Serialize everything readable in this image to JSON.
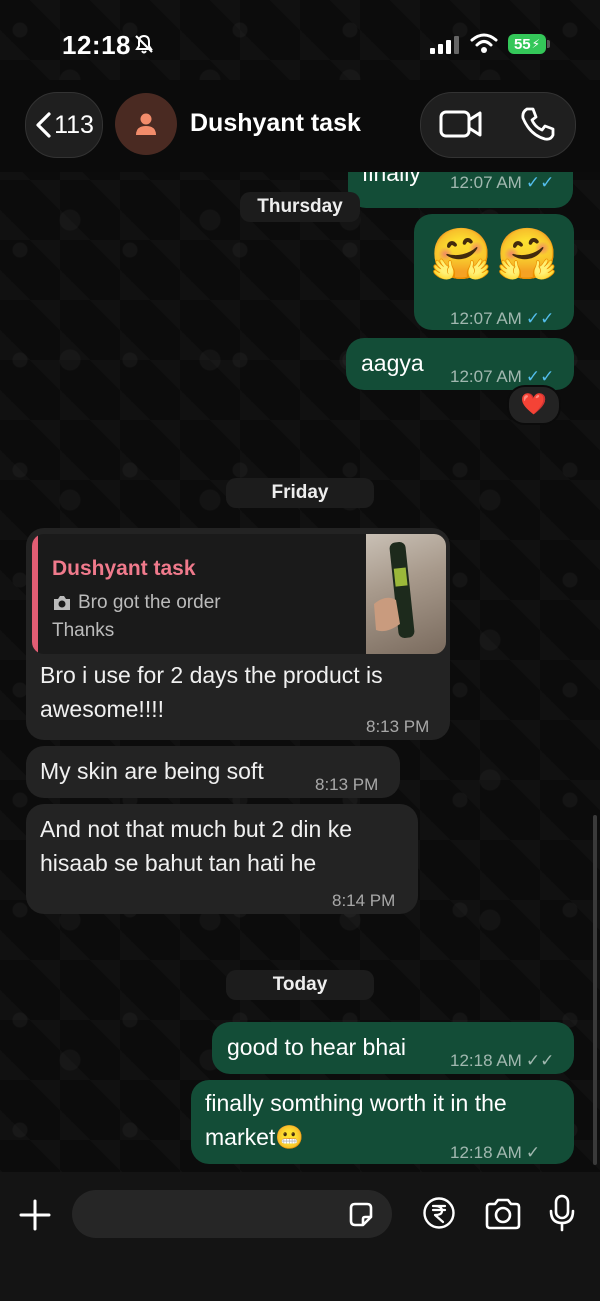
{
  "status_bar": {
    "time": "12:18",
    "battery": "55"
  },
  "header": {
    "back_count": "113",
    "contact_name": "Dushyant task"
  },
  "colors": {
    "outgoing_bubble": "#134d37",
    "incoming_bubble": "#232323",
    "read_ticks": "#53bdeb",
    "quote_name": "#f07a8c",
    "battery": "#34c759"
  },
  "messages": {
    "m0": {
      "text": "finally",
      "time": "12:07 AM",
      "ticks": "✓✓"
    },
    "date_thursday": "Thursday",
    "m1": {
      "emoji": "🤗🤗",
      "time": "12:07 AM",
      "ticks": "✓✓"
    },
    "m2": {
      "text": "aagya",
      "time": "12:07 AM",
      "ticks": "✓✓",
      "reaction": "❤️"
    },
    "date_friday": "Friday",
    "m3": {
      "quote_name": "Dushyant task",
      "quote_line1": "Bro got the order",
      "quote_line2": "Thanks",
      "text": "Bro i use for 2 days the product is awesome!!!!",
      "time": "8:13 PM"
    },
    "m4": {
      "text": "My skin are being soft",
      "time": "8:13 PM"
    },
    "m5": {
      "text": "And not that much but 2 din ke hisaab se bahut tan hati he",
      "time": "8:14 PM"
    },
    "date_today": "Today",
    "m6": {
      "text": "good to hear bhai",
      "time": "12:18 AM",
      "ticks": "✓✓"
    },
    "m7": {
      "text": "finally somthing worth it in the market",
      "emoji": "😬",
      "time": "12:18 AM",
      "ticks": "✓"
    }
  },
  "composer": {
    "value": "",
    "placeholder": ""
  },
  "icons": [
    "mute-icon",
    "signal-icon",
    "wifi-icon",
    "back-chevron-icon",
    "person-icon",
    "video-call-icon",
    "phone-icon",
    "camera-small-icon",
    "plus-icon",
    "sticker-icon",
    "rupee-icon",
    "camera-icon",
    "mic-icon"
  ]
}
